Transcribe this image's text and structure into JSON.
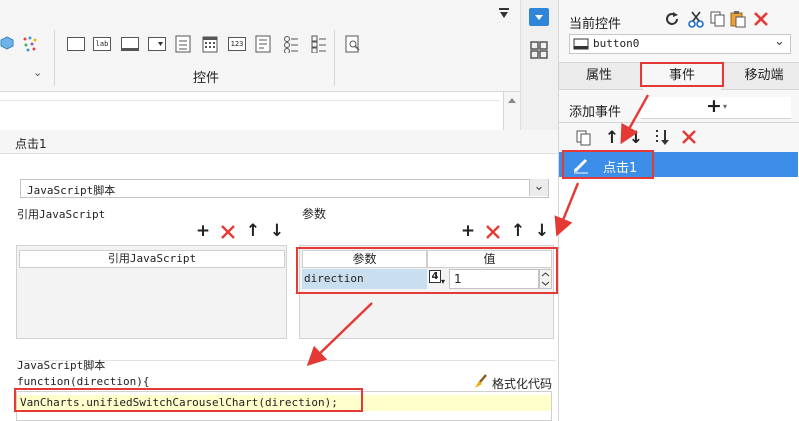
{
  "toolbar": {
    "section_label": "控件",
    "small_labels": {
      "lab": "lab",
      "num": "123"
    }
  },
  "right_panel": {
    "current_control_label": "当前控件",
    "selected_control": "button0",
    "tabs": [
      {
        "label": "属性"
      },
      {
        "label": "事件"
      },
      {
        "label": "移动端"
      }
    ],
    "add_event_label": "添加事件",
    "events": [
      {
        "label": "点击1"
      }
    ]
  },
  "dialog": {
    "title": "点击1",
    "type_select_value": "JavaScript脚本",
    "ref_js": {
      "section_label": "引用JavaScript",
      "column_header": "引用JavaScript"
    },
    "params": {
      "section_label": "参数",
      "headers": {
        "param": "参数",
        "value": "值"
      },
      "rows": [
        {
          "name": "direction",
          "type_badge": "4",
          "value": "1"
        }
      ]
    },
    "script": {
      "section_label": "JavaScript脚本",
      "signature": "function(direction){",
      "format_label": "格式化代码",
      "code_line": "VanCharts.unifiedSwitchCarouselChart(direction);"
    }
  },
  "colors": {
    "accent_red": "#e53935",
    "selected_blue": "#3d8ee8",
    "param_cell_bg": "#c9dff0",
    "code_highlight": "#ffffcc"
  }
}
